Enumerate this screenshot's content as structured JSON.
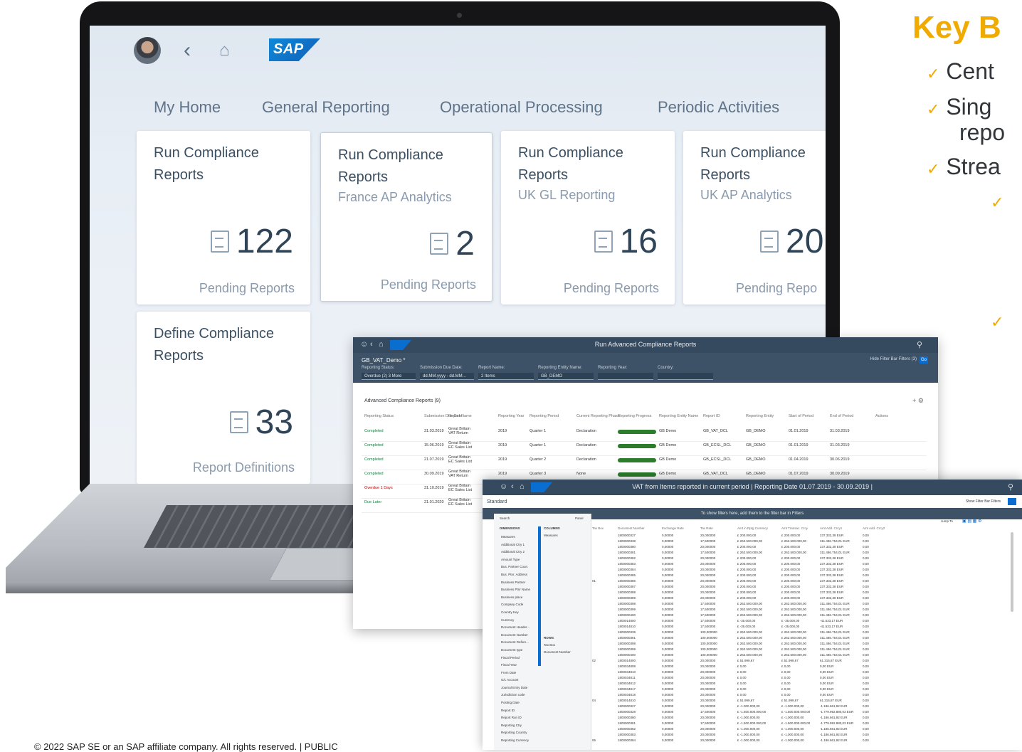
{
  "laptop": {
    "tabs": [
      "My Home",
      "General Reporting",
      "Operational Processing",
      "Periodic Activities"
    ],
    "sap_logo": "SAP",
    "tiles": [
      {
        "title": "Run Compliance Reports",
        "subtitle": "",
        "count": "122",
        "footer": "Pending Reports"
      },
      {
        "title": "Run Compliance Reports",
        "subtitle": "France AP Analytics",
        "count": "2",
        "footer": "Pending Reports"
      },
      {
        "title": "Run Compliance Reports",
        "subtitle": "UK GL Reporting",
        "count": "16",
        "footer": "Pending Reports"
      },
      {
        "title": "Run Compliance Reports",
        "subtitle": "UK AP Analytics",
        "count": "20",
        "footer": "Pending Repo"
      },
      {
        "title": "Define Compliance Reports",
        "subtitle": "",
        "count": "33",
        "footer": "Report Definitions"
      }
    ]
  },
  "report_window": {
    "title": "Run Advanced Compliance Reports",
    "variant": "GB_VAT_Demo *",
    "filters": [
      {
        "label": "Reporting Status:",
        "value": "Overdue (2)  3 More"
      },
      {
        "label": "Submission Due Date:",
        "value": "dd.MM.yyyy - dd.MM..."
      },
      {
        "label": "Report Name:",
        "value": "2 Items"
      },
      {
        "label": "Reporting Entity Name:",
        "value": "GB_DEMO"
      },
      {
        "label": "Reporting Year:",
        "value": ""
      },
      {
        "label": "Country:",
        "value": ""
      }
    ],
    "filter_right": "Hide Filter Bar   Filters (3)",
    "go": "Go",
    "table_title": "Advanced Compliance Reports (9)",
    "columns": [
      "Reporting Status",
      "Submission Due Date",
      "Report Name",
      "Reporting Year",
      "Reporting Period",
      "Current Reporting Phase",
      "Reporting Progress",
      "Reporting Entity Name",
      "Report ID",
      "Reporting Entity",
      "Start of Period",
      "End of Period",
      "Actions"
    ],
    "rows": [
      {
        "status": "Completed",
        "due": "31.03.2019",
        "name": "Great Britain VAT Return",
        "year": "2019",
        "period": "Quarter 1",
        "phase": "Declaration",
        "progress": 1.0,
        "entity": "GB Demo",
        "id": "GB_VAT_DCL",
        "ent": "GB_DEMO",
        "start": "01.01.2019",
        "end": "31.03.2019"
      },
      {
        "status": "Completed",
        "due": "15.06.2019",
        "name": "Great Britain EC Sales List",
        "year": "2019",
        "period": "Quarter 1",
        "phase": "Declaration",
        "progress": 1.0,
        "entity": "GB Demo",
        "id": "GB_ECSL_DCL",
        "ent": "GB_DEMO",
        "start": "01.01.2019",
        "end": "31.03.2019"
      },
      {
        "status": "Completed",
        "due": "21.07.2019",
        "name": "Great Britain EC Sales List",
        "year": "2019",
        "period": "Quarter 2",
        "phase": "Declaration",
        "progress": 1.0,
        "entity": "GB Demo",
        "id": "GB_ECSL_DCL",
        "ent": "GB_DEMO",
        "start": "01.04.2019",
        "end": "30.06.2019"
      },
      {
        "status": "Completed",
        "due": "30.09.2019",
        "name": "Great Britain VAT Return",
        "year": "2019",
        "period": "Quarter 3",
        "phase": "None",
        "progress": 1.0,
        "entity": "GB Demo",
        "id": "GB_VAT_DCL",
        "ent": "GB_DEMO",
        "start": "01.07.2019",
        "end": "30.09.2019"
      },
      {
        "status": "Overdue 1 Days",
        "due": "31.10.2019",
        "name": "Great Britain EC Sales List",
        "year": "",
        "period": "",
        "phase": "",
        "progress": 0,
        "entity": "",
        "id": "",
        "ent": "",
        "start": "",
        "end": ""
      },
      {
        "status": "Due Later",
        "due": "21.01.2020",
        "name": "Great Britain EC Sales List",
        "year": "",
        "period": "",
        "phase": "",
        "progress": 0,
        "entity": "",
        "id": "",
        "ent": "",
        "start": "",
        "end": ""
      }
    ]
  },
  "vat_window": {
    "title": "VAT from Items reported in current period | Reporting Date 01.07.2019 - 30.09.2019 |",
    "variant": "Standard",
    "subbar": "To show filters here, add them to the filter bar in Filters",
    "right_links": "Show Filter Bar   Filters",
    "search": "Search",
    "panel": "Panel",
    "dimensions_header": "DIMENSIONS",
    "columns_header": "COLUMNS",
    "columns_items": [
      "Measures"
    ],
    "rows_header": "ROWS",
    "rows_items": [
      "Tax Box",
      "Document Number"
    ],
    "dimensions": [
      "Measures",
      "Additional Ctry 1",
      "Additional Ctry 2",
      "Amount Type",
      "Bus. Partner Coun.",
      "Bus. Ptnr. Address",
      "Business Partner",
      "Business Ptnr Name",
      "Business place",
      "Company Code",
      "Country Key",
      "Currency",
      "Document Header...",
      "Document Number",
      "Document Refere...",
      "Document type",
      "Fiscal Period",
      "Fiscal Year",
      "From Date",
      "G/L Account",
      "Journal Entry Date",
      "Jurisdiction code",
      "Posting Date",
      "Report ID",
      "Report Run ID",
      "Reporting Ctry",
      "Reporting Country",
      "Reporting Currency"
    ],
    "grid_headers": [
      "Tax Box",
      "Document Number",
      "Exchange Rate",
      "Tax Rate",
      "Amt in Rptg Currency",
      "Amt Transac. Crcy",
      "Amt Add. Crcy1",
      "Amt Add. Crcy2"
    ],
    "jump_to": "Jump To",
    "tax_boxes": [
      "01",
      "02",
      "04",
      "06"
    ],
    "grid_rows": [
      [
        "1800000327",
        "0,00000",
        "20,000000",
        "£ 200.000,00",
        "£ 200.000,00",
        "237.332,38 EUR",
        "0,00"
      ],
      [
        "1800000338",
        "0,00000",
        "17,500000",
        "£ 262.500.000,00",
        "£ 262.500.000,00",
        "311.486.754,01 EUR",
        "0,00"
      ],
      [
        "1800000380",
        "0,00000",
        "20,000000",
        "£ 200.000,00",
        "£ 200.000,00",
        "237.332,38 EUR",
        "0,00"
      ],
      [
        "1800000381",
        "0,00000",
        "17,500000",
        "£ 262.500.000,00",
        "£ 262.500.000,00",
        "311.486.754,01 EUR",
        "0,00"
      ],
      [
        "1800000382",
        "0,00000",
        "20,000000",
        "£ 200.000,00",
        "£ 200.000,00",
        "237.332,38 EUR",
        "0,00"
      ],
      [
        "1800000383",
        "0,00000",
        "20,000000",
        "£ 200.000,00",
        "£ 200.000,00",
        "237.332,38 EUR",
        "0,00"
      ],
      [
        "1800000384",
        "0,00000",
        "20,000000",
        "£ 200.000,00",
        "£ 200.000,00",
        "237.332,38 EUR",
        "0,00"
      ],
      [
        "1800000385",
        "0,00000",
        "20,000000",
        "£ 200.000,00",
        "£ 200.000,00",
        "237.332,38 EUR",
        "0,00"
      ],
      [
        "1800000386",
        "0,00000",
        "20,000000",
        "£ 200.000,00",
        "£ 200.000,00",
        "237.332,38 EUR",
        "0,00"
      ],
      [
        "1800000387",
        "0,00000",
        "20,000000",
        "£ 200.000,00",
        "£ 200.000,00",
        "237.332,38 EUR",
        "0,00"
      ],
      [
        "1800000388",
        "0,00000",
        "20,000000",
        "£ 200.000,00",
        "£ 200.000,00",
        "237.332,38 EUR",
        "0,00"
      ],
      [
        "1800000389",
        "0,00000",
        "20,000000",
        "£ 200.000,00",
        "£ 200.000,00",
        "237.332,38 EUR",
        "0,00"
      ],
      [
        "1800000398",
        "0,00000",
        "17,500000",
        "£ 262.500.000,00",
        "£ 262.500.000,00",
        "311.486.754,01 EUR",
        "0,00"
      ],
      [
        "1800000399",
        "0,00000",
        "17,500000",
        "£ 262.500.000,00",
        "£ 262.500.000,00",
        "311.486.754,01 EUR",
        "0,00"
      ],
      [
        "1800000400",
        "0,00000",
        "17,500000",
        "£ 262.500.000,00",
        "£ 262.500.000,00",
        "311.486.754,01 EUR",
        "0,00"
      ],
      [
        "1800014800",
        "0,00000",
        "17,500000",
        "£ -35.000,00",
        "£ -35.000,00",
        "-41.533,17 EUR",
        "0,00"
      ],
      [
        "1800014810",
        "0,00000",
        "17,500000",
        "£ -35.000,00",
        "£ -35.000,00",
        "-41.533,17 EUR",
        "0,00"
      ],
      [
        "1800000339",
        "0,00000",
        "100,000000",
        "£ 262.500.000,00",
        "£ 262.500.000,00",
        "311.486.754,01 EUR",
        "0,00"
      ],
      [
        "1800000381",
        "0,00000",
        "100,000000",
        "£ 262.500.000,00",
        "£ 262.500.000,00",
        "311.486.754,01 EUR",
        "0,00"
      ],
      [
        "1800000398",
        "0,00000",
        "100,000000",
        "£ 262.500.000,00",
        "£ 262.500.000,00",
        "311.486.754,01 EUR",
        "0,00"
      ],
      [
        "1800000399",
        "0,00000",
        "100,000000",
        "£ 262.500.000,00",
        "£ 262.500.000,00",
        "311.486.754,01 EUR",
        "0,00"
      ],
      [
        "1800000400",
        "0,00000",
        "100,000000",
        "£ 262.500.000,00",
        "£ 262.500.000,00",
        "311.486.754,01 EUR",
        "0,00"
      ],
      [
        "1800014800",
        "0,00000",
        "20,000000",
        "£ 51.999,67",
        "£ 51.999,67",
        "61.315,87 EUR",
        "0,00"
      ],
      [
        "1800034808",
        "0,00000",
        "20,000000",
        "£ 0,00",
        "£ 0,00",
        "0,00 EUR",
        "0,00"
      ],
      [
        "1800034810",
        "0,00000",
        "20,000000",
        "£ 0,00",
        "£ 0,00",
        "0,00 EUR",
        "0,00"
      ],
      [
        "1800034811",
        "0,00000",
        "20,000000",
        "£ 0,00",
        "£ 0,00",
        "0,00 EUR",
        "0,00"
      ],
      [
        "1800034812",
        "0,00000",
        "20,000000",
        "£ 0,00",
        "£ 0,00",
        "0,00 EUR",
        "0,00"
      ],
      [
        "1800034817",
        "0,00000",
        "20,000000",
        "£ 0,00",
        "£ 0,00",
        "0,00 EUR",
        "0,00"
      ],
      [
        "1800034818",
        "0,00000",
        "20,000000",
        "£ 0,00",
        "£ 0,00",
        "0,00 EUR",
        "0,00"
      ],
      [
        "1800014810",
        "0,00000",
        "20,000000",
        "£ 51.999,67",
        "£ 51.999,67",
        "61.315,87 EUR",
        "0,00"
      ],
      [
        "1800000327",
        "0,00000",
        "20,000000",
        "£ -1.000.000,00",
        "£ -1.000.000,00",
        "-1.186.661,92 EUR",
        "0,00"
      ],
      [
        "1800000328",
        "0,00000",
        "17,500000",
        "£ -1.500.000.000,00",
        "£ -1.500.000.000,00",
        "-1.779.992.880,03 EUR",
        "0,00"
      ],
      [
        "1800000380",
        "0,00000",
        "20,000000",
        "£ -1.000.000,00",
        "£ -1.000.000,00",
        "-1.186.661,92 EUR",
        "0,00"
      ],
      [
        "1800000381",
        "0,00000",
        "17,500000",
        "£ -1.500.000.000,00",
        "£ -1.500.000.000,00",
        "-1.779.992.880,03 EUR",
        "0,00"
      ],
      [
        "1800000382",
        "0,00000",
        "20,000000",
        "£ -1.000.000,00",
        "£ -1.000.000,00",
        "-1.186.661,92 EUR",
        "0,00"
      ],
      [
        "1800000383",
        "0,00000",
        "20,000000",
        "£ -1.000.000,00",
        "£ -1.000.000,00",
        "-1.186.661,92 EUR",
        "0,00"
      ],
      [
        "1800000384",
        "0,00000",
        "20,000000",
        "£ -1.000.000,00",
        "£ -1.000.000,00",
        "-1.186.661,92 EUR",
        "0,00"
      ]
    ]
  },
  "key_benefits": {
    "title": "Key B",
    "bullets": [
      {
        "level": 1,
        "text": "Cent"
      },
      {
        "level": 1,
        "text": "Sing"
      },
      {
        "level": 0,
        "text": "repo"
      },
      {
        "level": 1,
        "text": "Strea"
      },
      {
        "level": 2,
        "text": ""
      },
      {
        "level": 2,
        "text": ""
      }
    ]
  },
  "footer": "© 2022 SAP SE or an SAP affiliate company. All rights reserved.  |  PUBLIC",
  "colors": {
    "accent": "#f0ab00",
    "shell": "#354a5f",
    "sap_blue": "#0a6ed1",
    "progress": "#2b7c2b",
    "overdue": "#bb0000",
    "completed": "#107e3e"
  }
}
